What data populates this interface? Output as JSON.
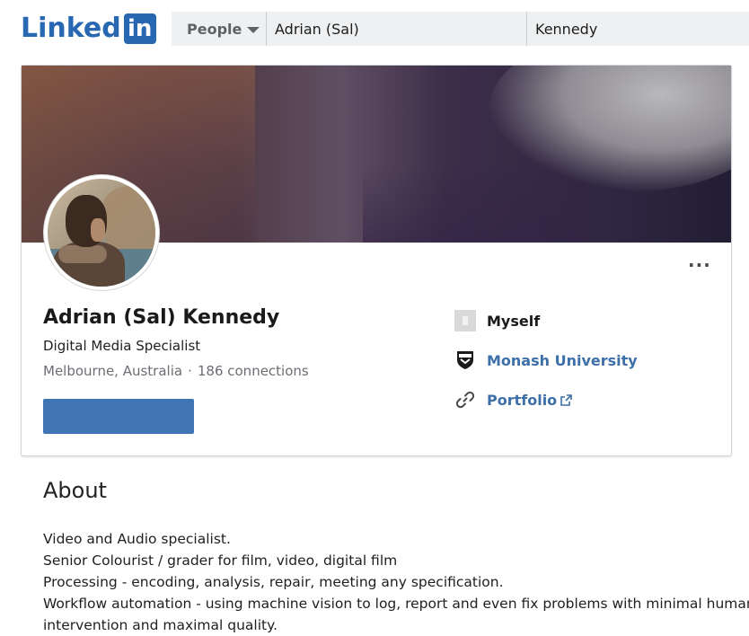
{
  "header": {
    "logo_text": "Linked",
    "logo_box": "in",
    "brand_color": "#2867b2",
    "search": {
      "type_label": "People",
      "first_name_value": "Adrian (Sal)",
      "last_name_value": "Kennedy"
    }
  },
  "profile": {
    "name": "Adrian (Sal) Kennedy",
    "headline": "Digital Media Specialist",
    "location": "Melbourne, Australia",
    "separator": "·",
    "connections": "186 connections",
    "connect_button_label": "",
    "more_label": "···",
    "side": {
      "current_company": "Myself",
      "education": "Monash University",
      "website": "Portfolio"
    },
    "link_color": "#3d6fa8",
    "button_color": "#3f75b5"
  },
  "about": {
    "title": "About",
    "lines": [
      "Video and Audio specialist.",
      "Senior Colourist / grader for film, video, digital film",
      "Processing - encoding, analysis, repair, meeting any specification.",
      "Workflow automation - using machine vision to log, report and even fix problems with minimal human",
      "intervention and maximal quality."
    ]
  }
}
